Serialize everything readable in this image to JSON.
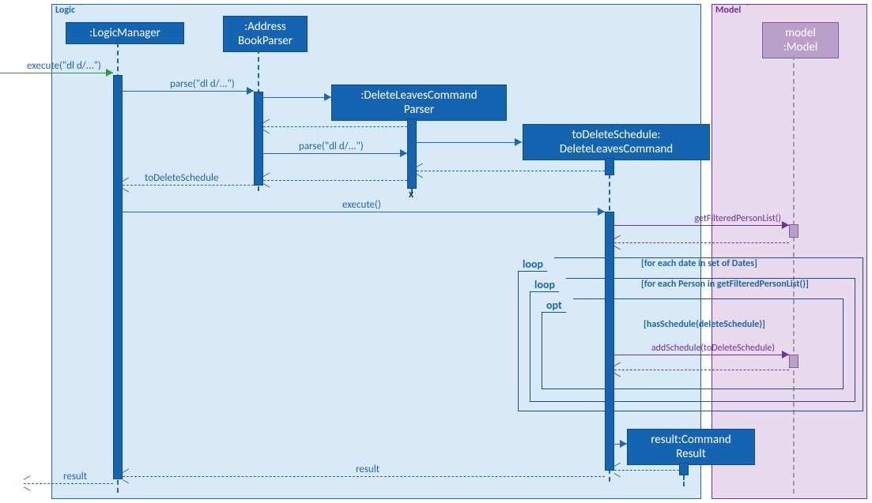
{
  "frames": {
    "logic": "Logic",
    "model": "Model"
  },
  "lifelines": {
    "lm": ":LogicManager",
    "abp": ":Address\nBookParser",
    "dlcp": ":DeleteLeavesCommand\nParser",
    "dlc": "toDeleteSchedule:\nDeleteLeavesCommand",
    "model": "model\n:Model",
    "cr": "result:Command\nResult"
  },
  "messages": {
    "exec_in": "execute(\"dl d/...\")",
    "parse1": "parse(\"dl d/...\")",
    "parse2": "parse(\"dl d/...\")",
    "ret_tds": "toDeleteSchedule",
    "exec": "execute()",
    "gfpl": "getFilteredPersonList()",
    "addSched": "addSchedule(toDeleteSchedule)",
    "result": "result"
  },
  "fragments": {
    "loop1": {
      "label": "loop",
      "guard": "[for each date in set of Dates]"
    },
    "loop2": {
      "label": "loop",
      "guard": "[for each Person in getFilteredPersonList()]"
    },
    "opt": {
      "label": "opt",
      "guard": "[hasSchedule(deleteSchedule)]"
    }
  }
}
